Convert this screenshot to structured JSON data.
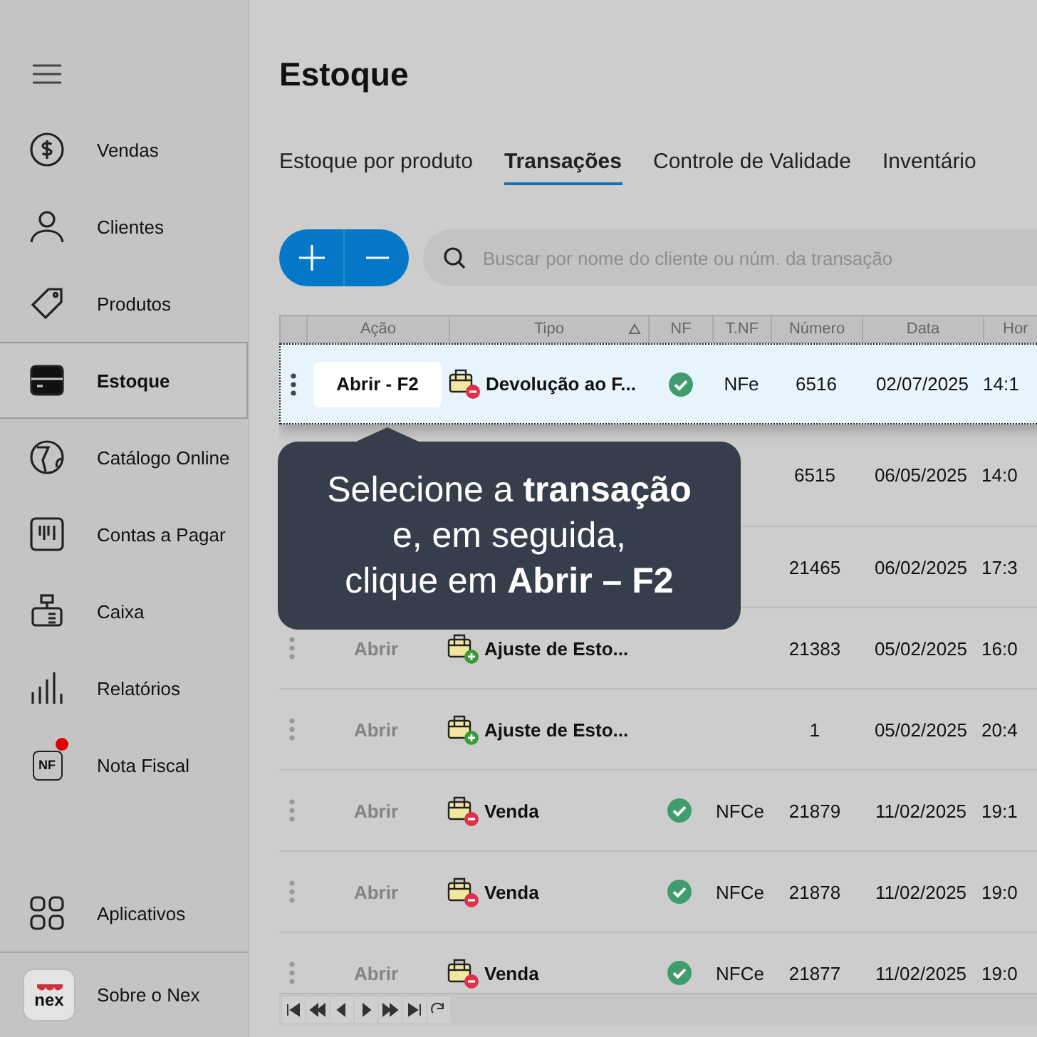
{
  "sidebar": {
    "items": [
      {
        "label": "Vendas",
        "selected": false,
        "alert": false
      },
      {
        "label": "Clientes",
        "selected": false,
        "alert": false
      },
      {
        "label": "Produtos",
        "selected": false,
        "alert": false
      },
      {
        "label": "Estoque",
        "selected": true,
        "alert": false
      },
      {
        "label": "Catálogo Online",
        "selected": false,
        "alert": false
      },
      {
        "label": "Contas a Pagar",
        "selected": false,
        "alert": false
      },
      {
        "label": "Caixa",
        "selected": false,
        "alert": false
      },
      {
        "label": "Relatórios",
        "selected": false,
        "alert": false
      },
      {
        "label": "Nota Fiscal",
        "selected": false,
        "alert": true,
        "icon_text": "NF"
      }
    ],
    "apps": {
      "label": "Aplicativos"
    },
    "about": {
      "label": "Sobre o Nex",
      "logo_text": "nex"
    }
  },
  "page": {
    "title": "Estoque"
  },
  "tabs": [
    {
      "label": "Estoque por produto",
      "selected": false
    },
    {
      "label": "Transações",
      "selected": true
    },
    {
      "label": "Controle de Validade",
      "selected": false
    },
    {
      "label": "Inventário",
      "selected": false
    }
  ],
  "search": {
    "placeholder": "Buscar por nome do cliente ou núm. da transação"
  },
  "table": {
    "columns": [
      {
        "label": "Ação",
        "sorted": false
      },
      {
        "label": "Tipo",
        "sorted": true
      },
      {
        "label": "NF",
        "sorted": false
      },
      {
        "label": "T.NF",
        "sorted": false
      },
      {
        "label": "Número",
        "sorted": false
      },
      {
        "label": "Data",
        "sorted": false
      },
      {
        "label": "Hor",
        "sorted": false
      }
    ],
    "rows": [
      {
        "selected": true,
        "action": "Abrir - F2",
        "type": {
          "kind": "minus",
          "label": "Devolução ao F..."
        },
        "nf": true,
        "tnf": "NFe",
        "number": "6516",
        "date": "02/07/2025",
        "time": "14:1"
      },
      {
        "selected": false,
        "number": "6515",
        "date": "06/05/2025",
        "time": "14:0"
      },
      {
        "selected": false,
        "number": "21465",
        "date": "06/02/2025",
        "time": "17:3"
      },
      {
        "selected": false,
        "action": "Abrir",
        "type": {
          "kind": "plus",
          "label": "Ajuste de Esto..."
        },
        "nf": false,
        "number": "21383",
        "date": "05/02/2025",
        "time": "16:0"
      },
      {
        "selected": false,
        "action": "Abrir",
        "type": {
          "kind": "plus",
          "label": "Ajuste de Esto..."
        },
        "nf": false,
        "number": "1",
        "date": "05/02/2025",
        "time": "20:4"
      },
      {
        "selected": false,
        "action": "Abrir",
        "type": {
          "kind": "minus",
          "label": "Venda"
        },
        "nf": true,
        "tnf": "NFCe",
        "number": "21879",
        "date": "11/02/2025",
        "time": "19:1"
      },
      {
        "selected": false,
        "action": "Abrir",
        "type": {
          "kind": "minus",
          "label": "Venda"
        },
        "nf": true,
        "tnf": "NFCe",
        "number": "21878",
        "date": "11/02/2025",
        "time": "19:0"
      },
      {
        "selected": false,
        "action": "Abrir",
        "type": {
          "kind": "minus",
          "label": "Venda"
        },
        "nf": true,
        "tnf": "NFCe",
        "number": "21877",
        "date": "11/02/2025",
        "time": "19:0"
      }
    ]
  },
  "tooltip": {
    "lines": [
      "Selecione a **transação**",
      "e, em seguida,",
      "clique em **Abrir – F2**"
    ]
  }
}
